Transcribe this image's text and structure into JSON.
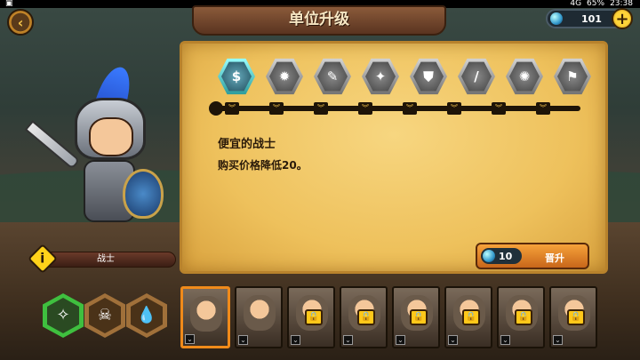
{
  "status_bar": {
    "left": "▣",
    "signal": "4G",
    "battery": "65%",
    "time": "23:38"
  },
  "header": {
    "title": "单位升级",
    "back_icon": "‹",
    "currency_value": "101",
    "add_icon": "+"
  },
  "skills": [
    {
      "icon": "$",
      "name": "coin-skill-icon",
      "active": true
    },
    {
      "icon": "✹",
      "name": "gear-skill-icon",
      "active": false
    },
    {
      "icon": "✎",
      "name": "claw-skill-icon",
      "active": false
    },
    {
      "icon": "✦",
      "name": "wing-skill-icon",
      "active": false
    },
    {
      "icon": "⛊",
      "name": "shield-skill-icon",
      "active": false
    },
    {
      "icon": "/",
      "name": "blade-skill-icon",
      "active": false
    },
    {
      "icon": "✺",
      "name": "star-skill-icon",
      "active": false
    },
    {
      "icon": "⚑",
      "name": "boot-skill-icon",
      "active": false
    }
  ],
  "rank_badges": [
    "︾",
    "︾",
    "︾",
    "︾",
    "︾",
    "︾",
    "︾",
    "︾"
  ],
  "detail": {
    "skill_name": "便宜的战士",
    "skill_desc": "购买价格降低20。"
  },
  "upgrade": {
    "cost": "10",
    "label": "晋升"
  },
  "hero": {
    "name": "战士",
    "info_icon": "i"
  },
  "abilities": [
    {
      "icon": "✧",
      "name": "rune-ability-icon",
      "border": "#3fbf3f",
      "fill": "#2a4a22"
    },
    {
      "icon": "☠",
      "name": "skull-ability-icon",
      "border": "#a0703a",
      "fill": "#4a3218"
    },
    {
      "icon": "💧",
      "name": "drop-ability-icon",
      "border": "#a0703a",
      "fill": "#4a3218"
    }
  ],
  "units": [
    {
      "name": "unit-card-warrior",
      "locked": false,
      "selected": true
    },
    {
      "name": "unit-card-rogue",
      "locked": false,
      "selected": false
    },
    {
      "name": "unit-card-pirate",
      "locked": true,
      "selected": false
    },
    {
      "name": "unit-card-knight",
      "locked": true,
      "selected": false
    },
    {
      "name": "unit-card-paladin",
      "locked": true,
      "selected": false
    },
    {
      "name": "unit-card-cannon",
      "locked": true,
      "selected": false
    },
    {
      "name": "unit-card-brute",
      "locked": true,
      "selected": false
    },
    {
      "name": "unit-card-gunner",
      "locked": true,
      "selected": false
    }
  ],
  "colors": {
    "accent": "#f08a1a",
    "parchment": "#eec15c",
    "title_plate": "#6a3a24"
  }
}
